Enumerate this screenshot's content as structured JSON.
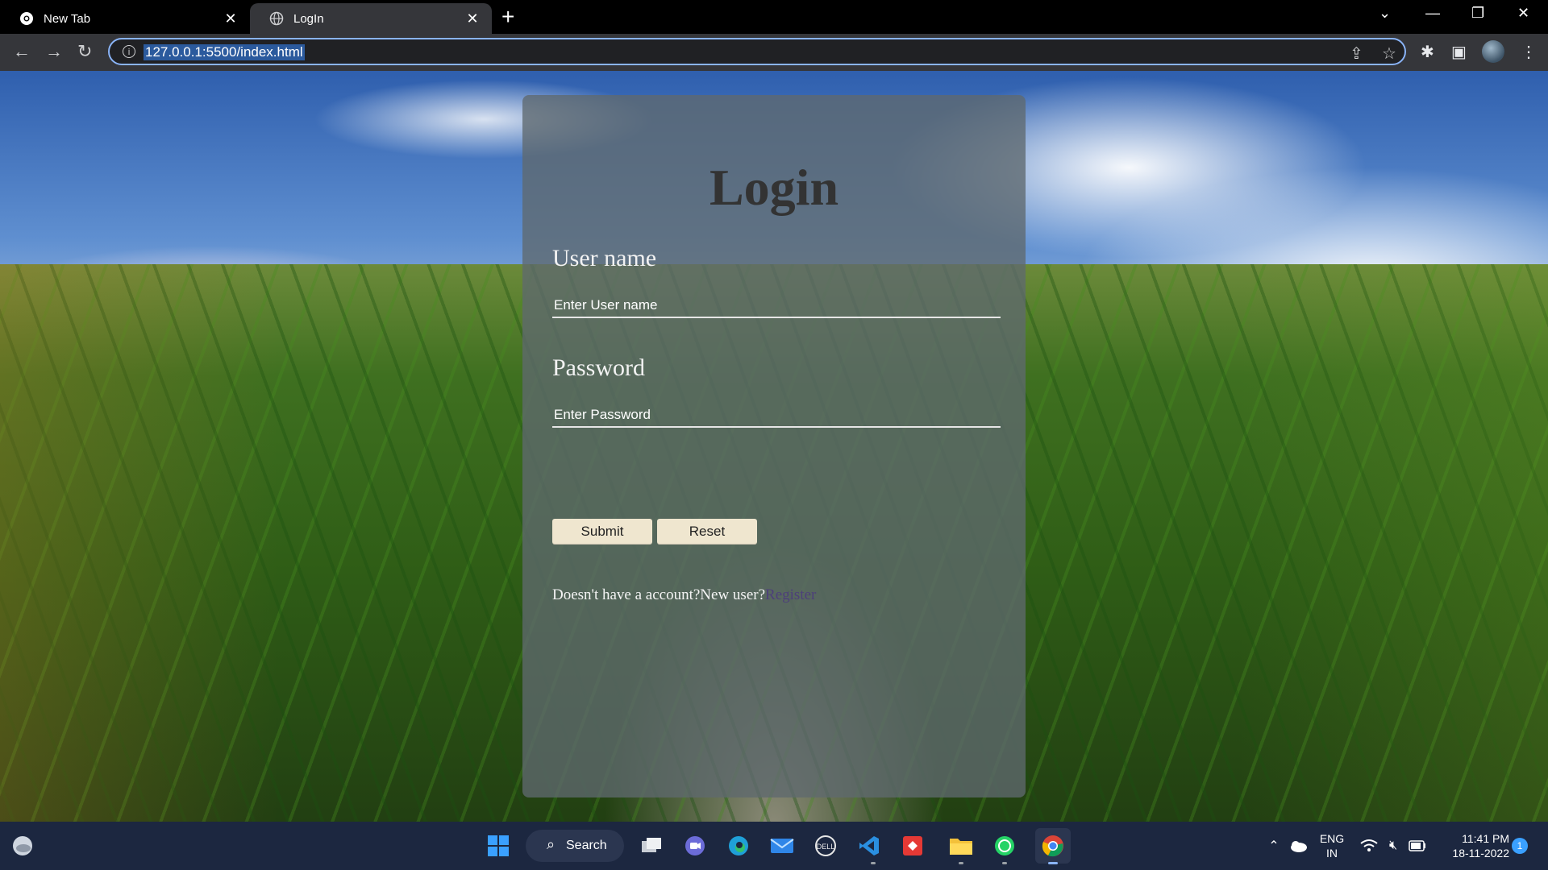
{
  "browser": {
    "tabs": [
      {
        "label": "New Tab",
        "icon": "chrome-icon",
        "active": false
      },
      {
        "label": "LogIn",
        "icon": "globe-icon",
        "active": true
      }
    ],
    "url": "127.0.0.1:5500/index.html",
    "accent": "#8ab4f8"
  },
  "login": {
    "title": "Login",
    "username_label": "User name",
    "username_placeholder": "Enter User name",
    "password_label": "Password",
    "password_placeholder": "Enter Password",
    "submit_label": "Submit",
    "reset_label": "Reset",
    "footer_text": "Doesn't have a account?New user?",
    "register_link": "Register"
  },
  "taskbar": {
    "search_label": "Search",
    "apps": [
      "windows-start-icon",
      "task-view-icon",
      "teams-chat-icon",
      "edge-icon",
      "mail-icon",
      "dell-icon",
      "vscode-icon",
      "anydesk-icon",
      "file-explorer-icon",
      "whatsapp-icon",
      "chrome-icon"
    ],
    "language": "ENG",
    "region": "IN",
    "time": "11:41 PM",
    "date": "18-11-2022",
    "notification_count": "1"
  }
}
